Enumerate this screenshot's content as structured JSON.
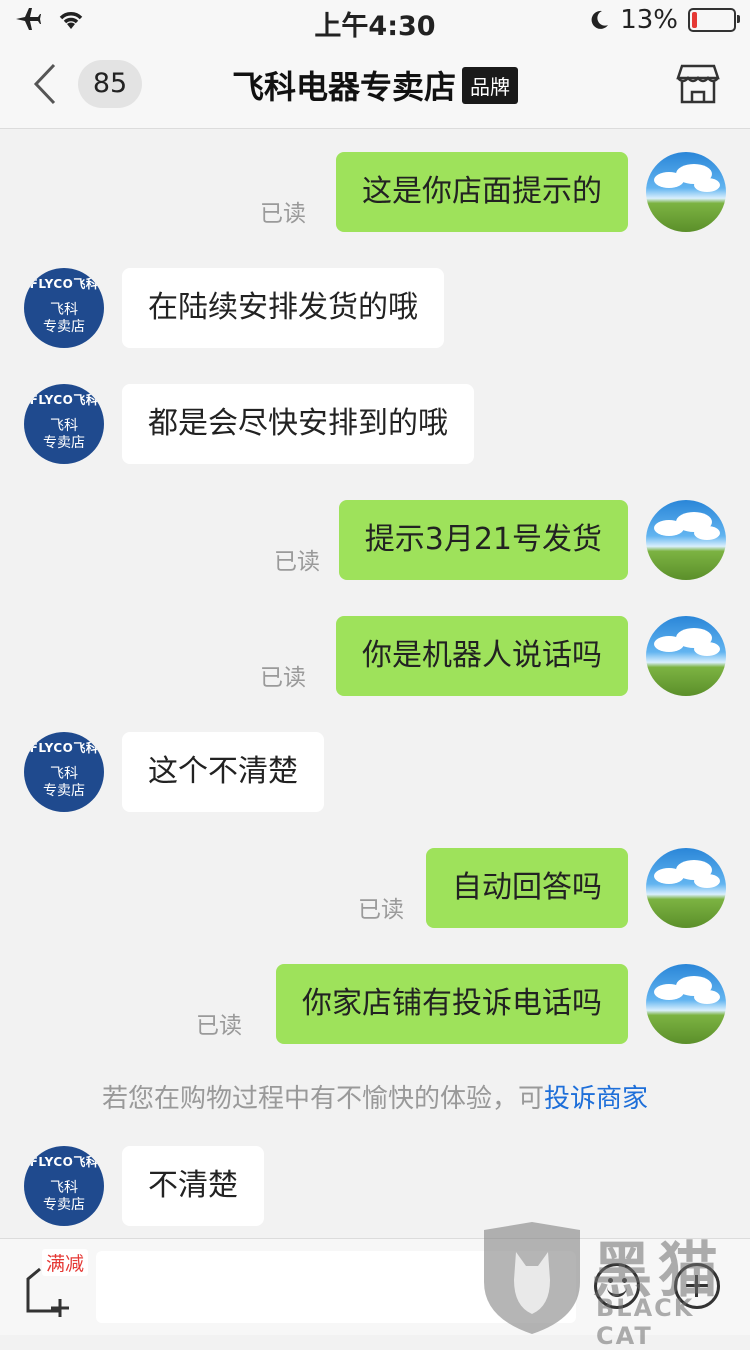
{
  "status_bar": {
    "time": "上午4:30",
    "battery": "13%",
    "battery_level": 0.13
  },
  "nav": {
    "unread_count": "85",
    "title": "飞科电器专卖店",
    "badge": "品牌"
  },
  "shop_avatar": {
    "brand": "FLYCO飞科",
    "line1": "飞科",
    "line2": "专卖店"
  },
  "messages": [
    {
      "side": "right",
      "text": "这是你店面提示的",
      "status": "已读"
    },
    {
      "side": "left",
      "text": "在陆续安排发货的哦"
    },
    {
      "side": "left",
      "text": "都是会尽快安排到的哦"
    },
    {
      "side": "right",
      "text": "提示3月21号发货",
      "status": "已读"
    },
    {
      "side": "right",
      "text": "你是机器人说话吗",
      "status": "已读"
    },
    {
      "side": "left",
      "text": "这个不清楚"
    },
    {
      "side": "right",
      "text": "自动回答吗",
      "status": "已读"
    },
    {
      "side": "right",
      "text": "你家店铺有投诉电话吗",
      "status": "已读"
    },
    {
      "side": "left",
      "text": "不清楚"
    }
  ],
  "notice": {
    "text": "若您在购物过程中有不愉快的体验，可",
    "link": "投诉商家"
  },
  "input_bar": {
    "promo_tag": "满减"
  },
  "watermark": {
    "cn": "黑猫",
    "en": "BLACK CAT"
  }
}
